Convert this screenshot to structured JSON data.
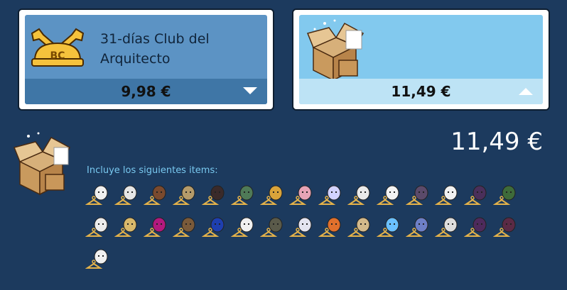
{
  "cards": [
    {
      "title_line1": "31-días Club del",
      "title_line2": "Arquitecto",
      "price": "9,98 €",
      "expanded": false,
      "icon": "bc-wrench-badge-icon",
      "badge_text": "BC"
    },
    {
      "price": "11,49 €",
      "expanded": true,
      "icon": "open-box-icon"
    }
  ],
  "detail": {
    "price": "11,49 €",
    "includes_label": "Incluye los siguientes items:",
    "items": [
      {
        "name": "white-mask-item",
        "color": "#f0f0f0"
      },
      {
        "name": "white-head-item",
        "color": "#e6e6e6"
      },
      {
        "name": "brown-jacket-item",
        "color": "#7a4a2e"
      },
      {
        "name": "straw-hat-item",
        "color": "#b59b6a"
      },
      {
        "name": "dark-hair-item",
        "color": "#3a2a2a"
      },
      {
        "name": "green-glasses-item",
        "color": "#4f7a57"
      },
      {
        "name": "gold-necklace-item",
        "color": "#d9a33a"
      },
      {
        "name": "pink-brain-item",
        "color": "#e7a3b5"
      },
      {
        "name": "colorful-face-item",
        "color": "#d2d2ff"
      },
      {
        "name": "black-beard-item",
        "color": "#eaeaea"
      },
      {
        "name": "white-helmet-item",
        "color": "#f3f3f3"
      },
      {
        "name": "purple-robe-item",
        "color": "#5b4a6a"
      },
      {
        "name": "skull-mask-item",
        "color": "#f1f1f1"
      },
      {
        "name": "dark-hood-item",
        "color": "#4a2f5a"
      },
      {
        "name": "green-suit-item",
        "color": "#3e6b3a"
      },
      {
        "name": "white-cap-item",
        "color": "#ececec"
      },
      {
        "name": "gold-frame-item",
        "color": "#d8b86b"
      },
      {
        "name": "magenta-hood-item",
        "color": "#b2197e"
      },
      {
        "name": "wand-item",
        "color": "#7a5a3a"
      },
      {
        "name": "blue-shoes-item",
        "color": "#1e3fb0"
      },
      {
        "name": "scream-mask-item",
        "color": "#f0f0f0"
      },
      {
        "name": "plague-mask-item",
        "color": "#5a5a4a"
      },
      {
        "name": "grey-face-item",
        "color": "#e3e3f0"
      },
      {
        "name": "orange-pattern-item",
        "color": "#e0702c"
      },
      {
        "name": "antlers-item",
        "color": "#d3b98a"
      },
      {
        "name": "blue-aura-item",
        "color": "#6ac0ff"
      },
      {
        "name": "blue-hair-item",
        "color": "#6d7fc7"
      },
      {
        "name": "spider-web-item",
        "color": "#dddddd"
      },
      {
        "name": "witch-hat-item",
        "color": "#4e2a5c"
      },
      {
        "name": "black-scarf-item",
        "color": "#5b2a45"
      },
      {
        "name": "white-mask-2-item",
        "color": "#f0f0f0"
      }
    ]
  }
}
